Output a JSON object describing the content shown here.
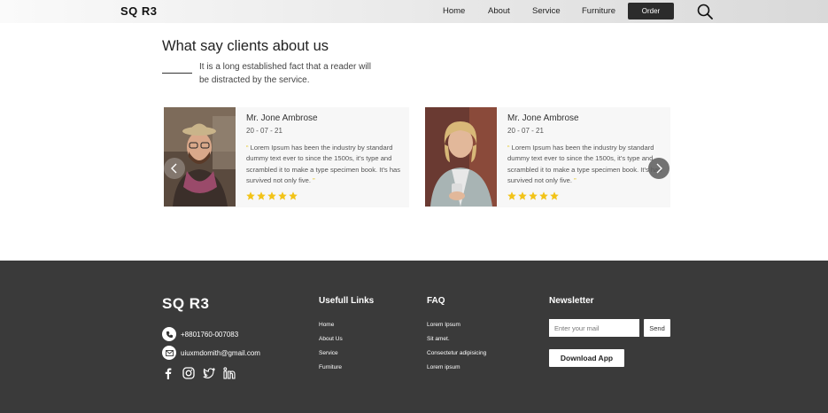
{
  "header": {
    "logo": "SQ R3",
    "nav": [
      "Home",
      "About",
      "Service",
      "Furniture"
    ],
    "order_label": "Order"
  },
  "testimonials": {
    "title": "What say clients about us",
    "subtitle": "It is a long established fact that a reader will be distracted by the service.",
    "cards": [
      {
        "name": "Mr. Jone Ambrose",
        "date": "20 - 07 - 21",
        "quote_open": "“",
        "text": "Lorem Ipsum has been the industry by standard dummy text ever to since the 1500s, it's type and scrambled it to make a type specimen book. It's has survived not only five.",
        "quote_close": "”",
        "rating": 5
      },
      {
        "name": "Mr. Jone Ambrose",
        "date": "20 - 07 - 21",
        "quote_open": "“",
        "text": "Lorem Ipsum has been the industry by standard dummy text ever to since the 1500s, it's type and scrambled it to make a type specimen book. It's has survived not only five.",
        "quote_close": "”",
        "rating": 5
      }
    ],
    "star_color": "#f2c318"
  },
  "footer": {
    "logo": "SQ R3",
    "phone": "+8801760-007083",
    "email": "uiuxmdomith@gmail.com",
    "useful_links": {
      "heading": "Usefull Links",
      "items": [
        "Home",
        "About Us",
        "Service",
        "Furniture"
      ]
    },
    "faq": {
      "heading": "FAQ",
      "items": [
        "Lorem Ipsum",
        "Sit amet.",
        "Consectetur adipisicing",
        "Lorem ipsum"
      ]
    },
    "newsletter": {
      "heading": "Newsletter",
      "placeholder": "Enter your mail",
      "send_label": "Send",
      "download_label": "Download App"
    },
    "socials": [
      "facebook-icon",
      "instagram-icon",
      "twitter-icon",
      "linkedin-icon"
    ]
  }
}
